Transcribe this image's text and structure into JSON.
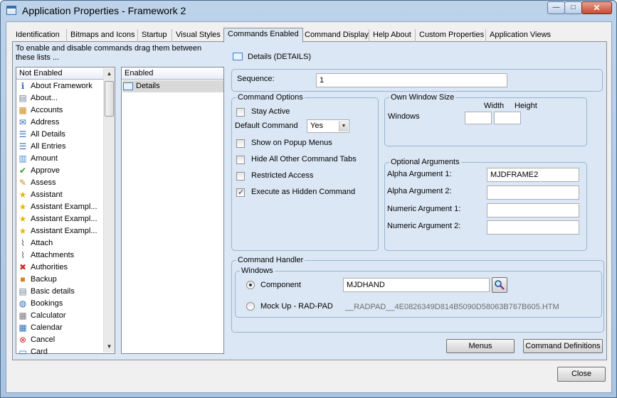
{
  "window": {
    "title": "Application Properties - Framework 2",
    "controls": {
      "minimize": "—",
      "maximize": "□",
      "close": "✕"
    }
  },
  "tabs": [
    {
      "label": "Identification"
    },
    {
      "label": "Bitmaps and Icons"
    },
    {
      "label": "Startup"
    },
    {
      "label": "Visual Styles"
    },
    {
      "label": "Commands Enabled",
      "active": true
    },
    {
      "label": "Command Display"
    },
    {
      "label": "Help About"
    },
    {
      "label": "Custom Properties"
    },
    {
      "label": "Application Views"
    }
  ],
  "instruction": "To enable and disable commands drag them between these lists ...",
  "not_enabled": {
    "header": "Not Enabled",
    "items": [
      {
        "label": "About Framework",
        "icon": "info-icon"
      },
      {
        "label": "About...",
        "icon": "document-icon"
      },
      {
        "label": "Accounts",
        "icon": "accounts-icon"
      },
      {
        "label": "Address",
        "icon": "envelope-icon"
      },
      {
        "label": "All Details",
        "icon": "list-icon"
      },
      {
        "label": "All Entries",
        "icon": "list-icon"
      },
      {
        "label": "Amount",
        "icon": "bin-icon"
      },
      {
        "label": "Approve",
        "icon": "check-icon"
      },
      {
        "label": "Assess",
        "icon": "pencil-icon"
      },
      {
        "label": "Assistant",
        "icon": "star-icon"
      },
      {
        "label": "Assistant Exampl...",
        "icon": "star-icon"
      },
      {
        "label": "Assistant Exampl...",
        "icon": "star-icon"
      },
      {
        "label": "Assistant Exampl...",
        "icon": "star-icon"
      },
      {
        "label": "Attach",
        "icon": "paperclip-icon"
      },
      {
        "label": "Attachments",
        "icon": "paperclip-icon"
      },
      {
        "label": "Authorities",
        "icon": "x-icon"
      },
      {
        "label": "Backup",
        "icon": "backup-icon"
      },
      {
        "label": "Basic details",
        "icon": "document-icon"
      },
      {
        "label": "Bookings",
        "icon": "globe-icon"
      },
      {
        "label": "Calculator",
        "icon": "calculator-icon"
      },
      {
        "label": "Calendar",
        "icon": "calendar-icon"
      },
      {
        "label": "Cancel",
        "icon": "cancel-icon"
      },
      {
        "label": "Card",
        "icon": "card-icon"
      }
    ]
  },
  "enabled": {
    "header": "Enabled",
    "items": [
      {
        "label": "Details",
        "icon": "window-icon"
      }
    ]
  },
  "details_header": "Details (DETAILS)",
  "sequence": {
    "label": "Sequence:",
    "value": "1"
  },
  "command_options": {
    "title": "Command Options",
    "stay_active": "Stay Active",
    "default_command_label": "Default Command",
    "default_command_value": "Yes",
    "show_popup": "Show on Popup Menus",
    "hide_tabs": "Hide All Other Command Tabs",
    "restricted": "Restricted Access",
    "execute_hidden": "Execute as Hidden Command"
  },
  "own_window": {
    "title": "Own Window Size",
    "windows_label": "Windows",
    "width_label": "Width",
    "height_label": "Height",
    "width_value": "",
    "height_value": ""
  },
  "optional_args": {
    "title": "Optional Arguments",
    "alpha1_label": "Alpha Argument 1:",
    "alpha1_value": "MJDFRAME2",
    "alpha2_label": "Alpha Argument 2:",
    "alpha2_value": "",
    "num1_label": "Numeric Argument 1:",
    "num1_value": "",
    "num2_label": "Numeric Argument 2:",
    "num2_value": ""
  },
  "command_handler": {
    "title": "Command Handler",
    "windows_title": "Windows",
    "component_label": "Component",
    "component_value": "MJDHAND",
    "mockup_label": "Mock Up - RAD-PAD",
    "mockup_value": "__RADPAD__4E0826349D814B5090D58063B767B605.HTM"
  },
  "buttons": {
    "menus": "Menus",
    "command_definitions": "Command Definitions",
    "close": "Close"
  }
}
